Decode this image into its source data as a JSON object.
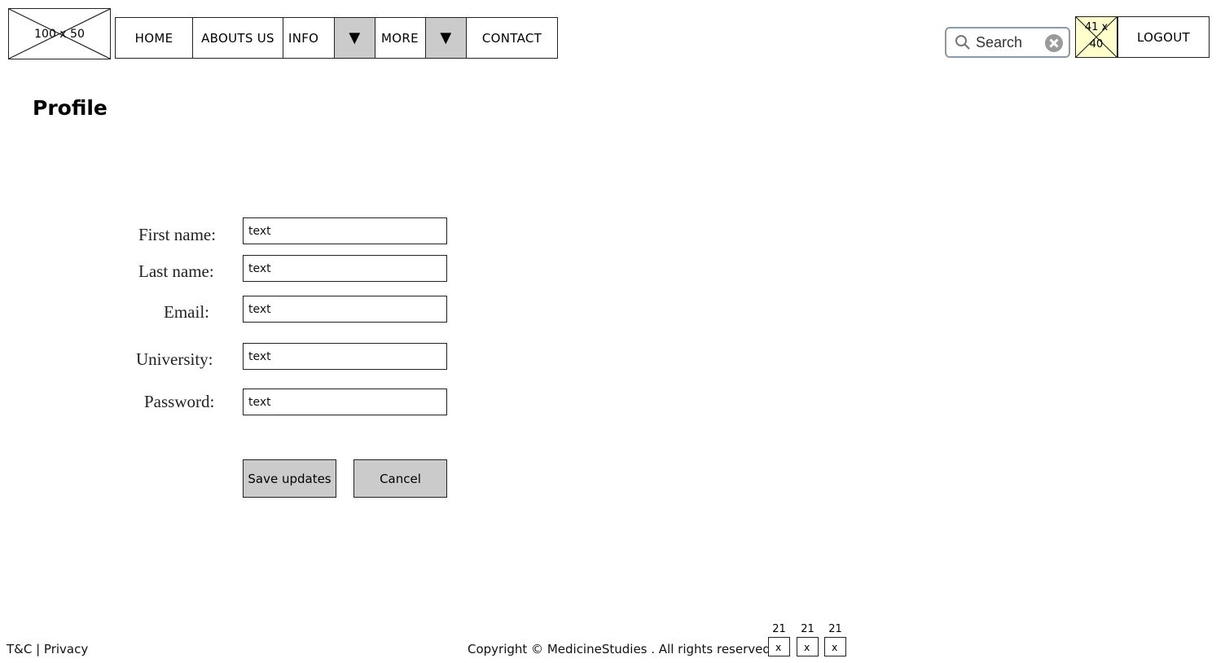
{
  "header": {
    "logo_label": "100 x 50",
    "nav": [
      {
        "label": "HOME"
      },
      {
        "label": "ABOUTS US"
      },
      {
        "label": "INFO"
      },
      {
        "label": "MORE"
      },
      {
        "label": "CONTACT"
      }
    ],
    "dropdown_glyph": "▼",
    "search_placeholder": "Search",
    "avatar_label_top": "41 x",
    "avatar_label_bottom": "40",
    "logout_label": "LOGOUT"
  },
  "page": {
    "title": "Profile"
  },
  "form": {
    "fields": [
      {
        "label": "First name:",
        "value": "text"
      },
      {
        "label": "Last name:",
        "value": "text"
      },
      {
        "label": "Email:",
        "value": "text"
      },
      {
        "label": "University:",
        "value": "text"
      },
      {
        "label": "Password:",
        "value": "text"
      }
    ],
    "save_label": "Save updates",
    "cancel_label": "Cancel"
  },
  "footer": {
    "links": "T&C | Privacy",
    "copyright": "Copyright © MedicineStudies . All rights reserved.",
    "social": [
      {
        "top": "21",
        "icon": "social-icon"
      },
      {
        "top": "21",
        "icon": "social-icon"
      },
      {
        "top": "21",
        "icon": "social-icon"
      }
    ]
  },
  "colors": {
    "button_fill": "#cbcbcb",
    "avatar_fill": "#ffffcc",
    "search_border": "#8c9aa8"
  }
}
